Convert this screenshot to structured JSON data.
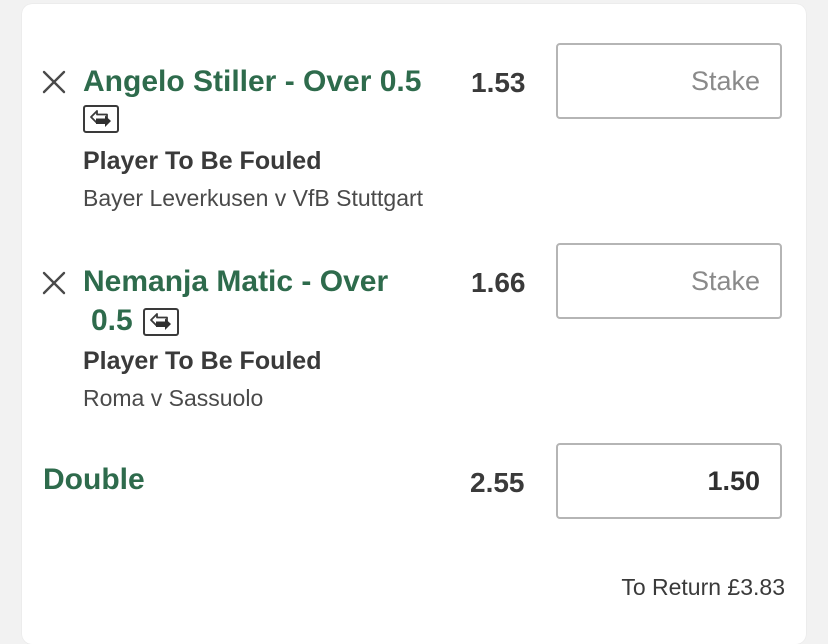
{
  "selections": [
    {
      "title_line1": "Angelo Stiller - Over 0.5",
      "market": "Player To Be Fouled",
      "event": "Bayer Leverkusen v VfB Stuttgart",
      "odds": "1.53",
      "stake_placeholder": "Stake",
      "icon": "swap-arrows-icon"
    },
    {
      "title_line1": "Nemanja Matic - Over",
      "title_line2": "0.5",
      "market": "Player To Be Fouled",
      "event": "Roma v Sassuolo",
      "odds": "1.66",
      "stake_placeholder": "Stake",
      "icon": "swap-arrows-icon"
    }
  ],
  "multiple": {
    "label": "Double",
    "odds": "2.55",
    "stake_value": "1.50"
  },
  "to_return": "To Return £3.83",
  "colors": {
    "brand_green": "#2e6b4c",
    "text_dark": "#3a3a3a",
    "border": "#b5b5b5"
  }
}
